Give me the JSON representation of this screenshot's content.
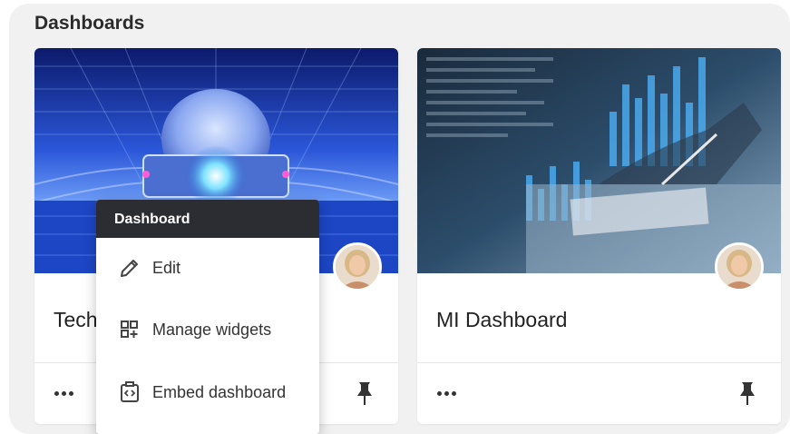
{
  "section": {
    "title": "Dashboards"
  },
  "cards": [
    {
      "title": "Tech",
      "more_icon": "ellipsis-icon",
      "pin_icon": "pin-icon"
    },
    {
      "title": "MI Dashboard",
      "more_icon": "ellipsis-icon",
      "pin_icon": "pin-icon"
    }
  ],
  "menu": {
    "header": "Dashboard",
    "items": [
      {
        "label": "Edit",
        "icon": "pencil-icon"
      },
      {
        "label": "Manage widgets",
        "icon": "widgets-icon"
      },
      {
        "label": "Embed dashboard",
        "icon": "embed-icon"
      }
    ]
  },
  "colors": {
    "panel_bg": "#f1f1f1",
    "menu_header_bg": "#2c2c33",
    "card_bg": "#ffffff"
  }
}
